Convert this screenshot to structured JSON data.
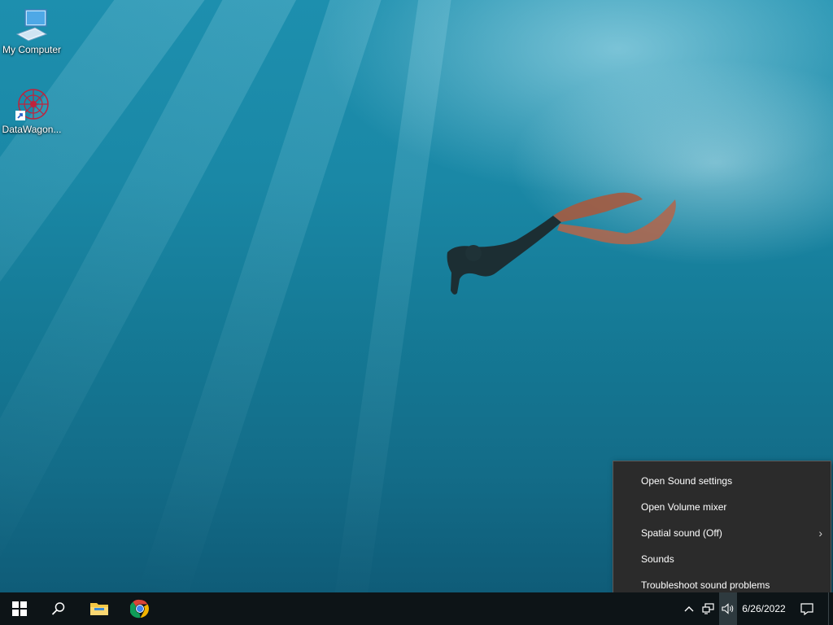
{
  "desktop": {
    "icons": [
      {
        "label": "My Computer",
        "icon": "computer-icon"
      },
      {
        "label": "DataWagon...",
        "icon": "datawagon-shortcut-icon"
      }
    ]
  },
  "context_menu": {
    "items": [
      {
        "label": "Open Sound settings"
      },
      {
        "label": "Open Volume mixer"
      },
      {
        "label": "Spatial sound (Off)",
        "has_submenu": true
      },
      {
        "label": "Sounds"
      },
      {
        "label": "Troubleshoot sound problems"
      }
    ]
  },
  "taskbar": {
    "start": "windows-start-icon",
    "search": "search-icon",
    "pinned": [
      "file-explorer-icon",
      "chrome-icon"
    ],
    "tray": {
      "show_hidden": "chevron-up-icon",
      "network": "network-icon",
      "volume": "volume-icon",
      "date": "6/26/2022",
      "notifications": "notification-icon"
    }
  },
  "colors": {
    "menu_bg": "#2b2b2b",
    "taskbar_bg": "#0d1417",
    "chrome_red": "#db4437",
    "chrome_yellow": "#f4b400",
    "chrome_green": "#0f9d58",
    "chrome_blue": "#4285f4",
    "folder_yellow": "#f3c744"
  }
}
